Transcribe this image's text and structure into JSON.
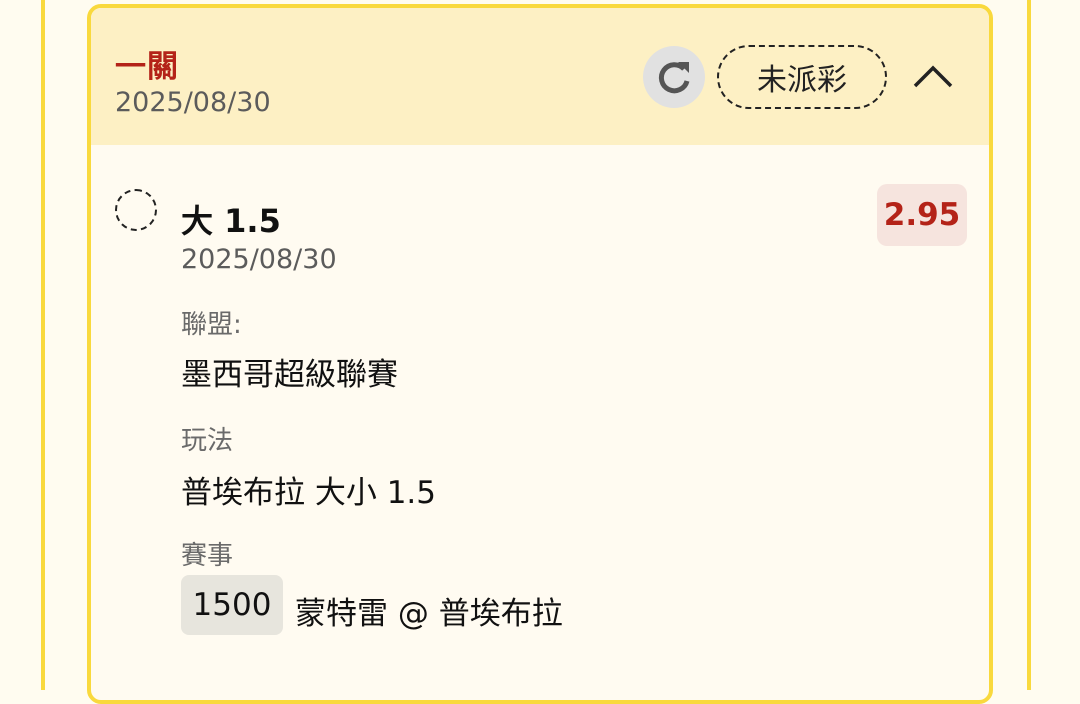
{
  "bet": {
    "type": "一關",
    "date": "2025/08/30",
    "status": "未派彩"
  },
  "icons": {
    "refresh": "refresh-icon",
    "collapse": "chevron-up-icon",
    "selection": "dashed-circle-icon"
  },
  "selection": {
    "name": "大 1.5",
    "date": "2025/08/30",
    "odds": "2.95",
    "league_label": "聯盟:",
    "league": "墨西哥超級聯賽",
    "play_label": "玩法",
    "play": "普埃布拉 大小 1.5",
    "match_label": "賽事",
    "match_code": "1500",
    "match_teams": "蒙特雷 @ 普埃布拉"
  },
  "colors": {
    "accent_red": "#b42318",
    "border_yellow": "#f9d93d",
    "header_bg": "#fdf0c4",
    "odds_bg": "#f6e4de"
  }
}
